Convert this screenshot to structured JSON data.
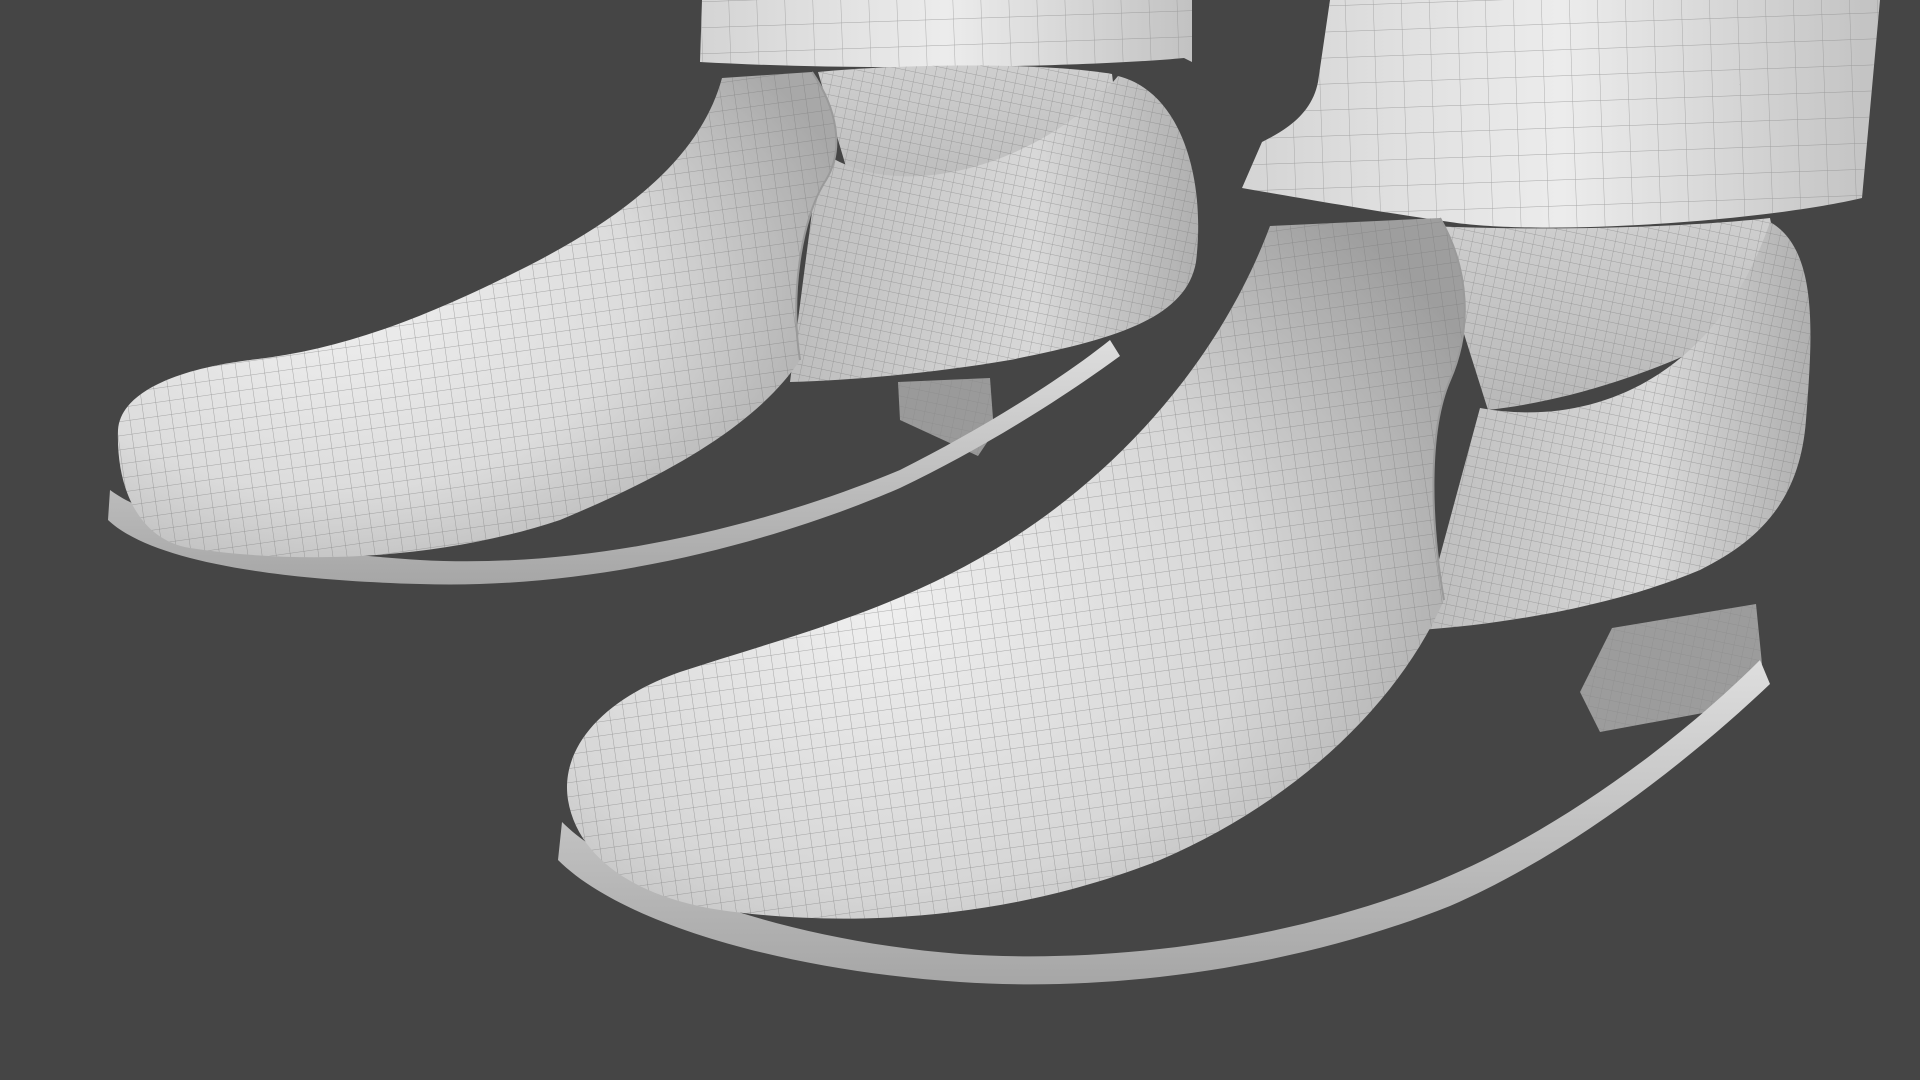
{
  "scene": {
    "subject": "3d-wireframe-render",
    "objects": [
      "left-shoe",
      "right-shoe",
      "left-trouser-cuff",
      "right-trouser-cuff"
    ]
  },
  "colors": {
    "background": "#454545",
    "surface_light": "#e6e6e6",
    "surface_mid": "#c9c9c9",
    "surface_shadow": "#a9a9a9",
    "wire": "#7a7a7a"
  }
}
